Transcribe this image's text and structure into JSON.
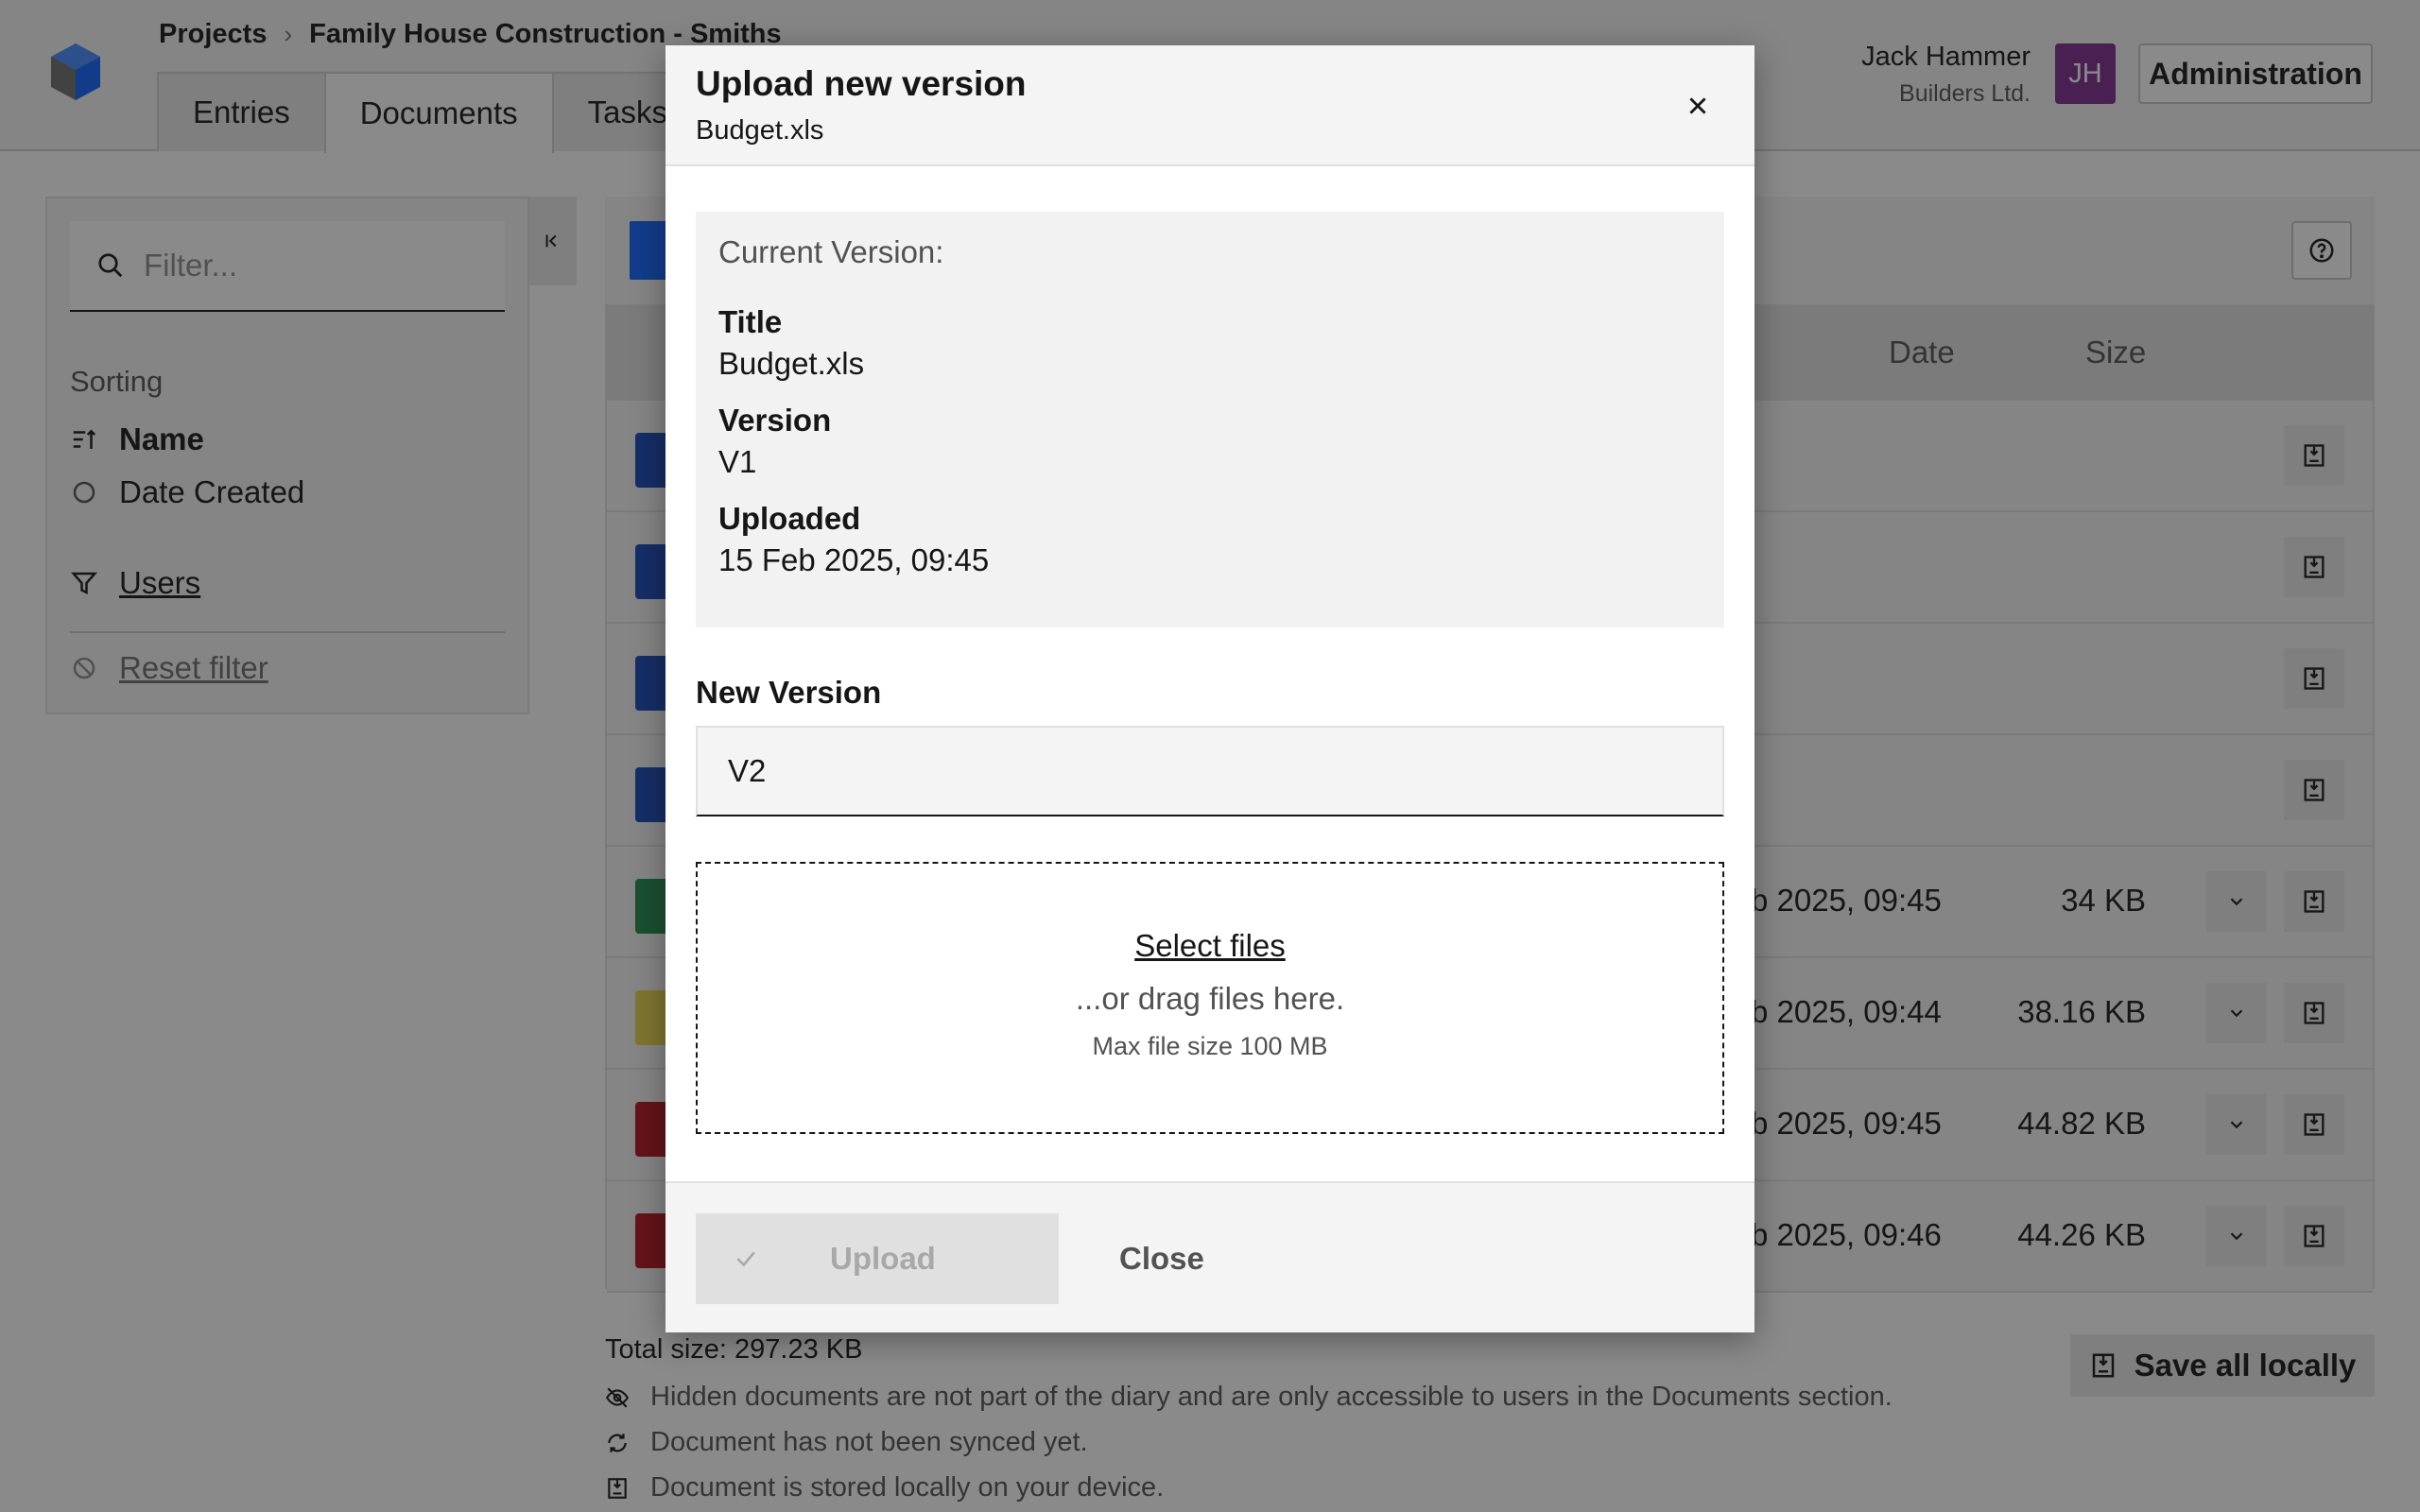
{
  "header": {
    "breadcrumb": [
      "Projects",
      "Family House Construction - Smiths"
    ],
    "tabs": [
      "Entries",
      "Documents",
      "Tasks"
    ],
    "user_name": "Jack Hammer",
    "user_company": "Builders Ltd.",
    "avatar_initials": "JH",
    "admin_label": "Administration"
  },
  "sidebar": {
    "filter_placeholder": "Filter...",
    "sorting_title": "Sorting",
    "sort_options": [
      "Name",
      "Date Created"
    ],
    "users_label": "Users",
    "reset_label": "Reset filter"
  },
  "table": {
    "columns": [
      "Date",
      "Size"
    ],
    "rows": [
      {
        "type": "folder",
        "color": "#1646b8",
        "date": "",
        "size": ""
      },
      {
        "type": "folder",
        "color": "#1646b8",
        "date": "",
        "size": ""
      },
      {
        "type": "folder",
        "color": "#1646b8",
        "date": "",
        "size": ""
      },
      {
        "type": "folder",
        "color": "#1646b8",
        "date": "",
        "size": ""
      },
      {
        "type": "sheet",
        "color": "#1f8a4c",
        "date": "b 2025, 09:45",
        "size": "34 KB"
      },
      {
        "type": "zip",
        "color": "#e8d44d",
        "date": "b 2025, 09:44",
        "size": "38.16 KB"
      },
      {
        "type": "pdf",
        "color": "#b3121a",
        "date": "b 2025, 09:45",
        "size": "44.82 KB"
      },
      {
        "type": "pdf",
        "color": "#b3121a",
        "date": "b 2025, 09:46",
        "size": "44.26 KB"
      }
    ]
  },
  "footer": {
    "total": "Total size: 297.23 KB",
    "legend": [
      "Hidden documents are not part of the diary and are only accessible to users in the Documents section.",
      "Document has not been synced yet.",
      "Document is stored locally on your device."
    ],
    "save_all": "Save all locally"
  },
  "modal": {
    "title": "Upload new version",
    "subtitle": "Budget.xls",
    "current_label": "Current Version:",
    "fields": [
      {
        "key": "Title",
        "value": "Budget.xls"
      },
      {
        "key": "Version",
        "value": "V1"
      },
      {
        "key": "Uploaded",
        "value": "15 Feb 2025, 09:45"
      }
    ],
    "new_version_label": "New Version",
    "new_version_value": "V2",
    "dropzone_select": "Select files",
    "dropzone_drag": "...or drag files here.",
    "dropzone_max": "Max file size 100 MB",
    "upload_label": "Upload",
    "close_label": "Close"
  },
  "colors": {
    "brand_blue": "#0f62fe",
    "avatar_bg": "#7b2c8f",
    "overlay": "rgba(22,22,22,0.5)"
  }
}
